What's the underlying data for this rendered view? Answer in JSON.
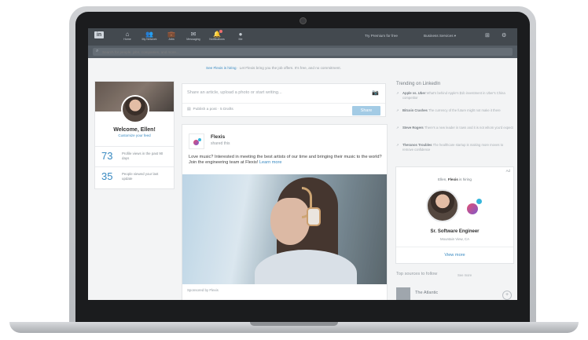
{
  "nav": {
    "logo": "in",
    "items": [
      {
        "icon": "⌂",
        "label": "Home"
      },
      {
        "icon": "👥",
        "label": "My Network"
      },
      {
        "icon": "💼",
        "label": "Jobs"
      },
      {
        "icon": "✉",
        "label": "Messaging"
      },
      {
        "icon": "🔔",
        "label": "Notifications"
      },
      {
        "icon": "●",
        "label": "Me"
      }
    ],
    "premium": "Try Premium for free",
    "business": "Business Services ▾"
  },
  "search": {
    "placeholder": "Search for people, jobs, companies, and more..."
  },
  "promo": {
    "link": "See Flexis is hiring",
    "text": "· Let Flexis bring you the job offers. It's free, and no commitment."
  },
  "profile": {
    "welcome": "Welcome, Ellen!",
    "customize": "Customize your feed",
    "stats": [
      {
        "num": "73",
        "text": "Profile views in the past 90 days"
      },
      {
        "num": "35",
        "text": "People viewed your last update"
      }
    ]
  },
  "composer": {
    "placeholder": "Share an article, upload a photo or start writing...",
    "publish": "Publish a post · 5 Drafts",
    "share": "Share"
  },
  "post": {
    "name": "Flexis",
    "sub": "shared this",
    "text": "Love music? Interested in meeting the best artists of our time and bringing their music to the world? Join the engineering team at Flexis!",
    "link": "Learn more",
    "sponsored": "Sponsored by Flexis"
  },
  "trending": {
    "title": "Trending on LinkedIn",
    "items": [
      {
        "bold": "Apple vs. Uber",
        "text": "What's behind Apple's $1b investment in Uber's China competitor"
      },
      {
        "bold": "Bitcoin Crashes",
        "text": "The currency of the future might not make it there"
      },
      {
        "bold": "Steve Rogers",
        "text": "There's a new leader in town and it is not whom you'd expect"
      },
      {
        "bold": "Theranos Troubles",
        "text": "The healthcare startup is making more moves to remove confidence"
      }
    ]
  },
  "ad": {
    "label": "Ad",
    "hiring_pre": "Ellen,",
    "hiring_brand": "Flexis",
    "hiring_post": "is hiring",
    "role": "Sr. Software Engineer",
    "location": "Mountain View, CA",
    "cta": "View more"
  },
  "follow": {
    "title": "Top sources to follow",
    "see_more": "See more",
    "source": "The Atlantic",
    "plus": "+"
  },
  "colors": {
    "accent": "#2a81bd",
    "navbar": "#383e45"
  }
}
